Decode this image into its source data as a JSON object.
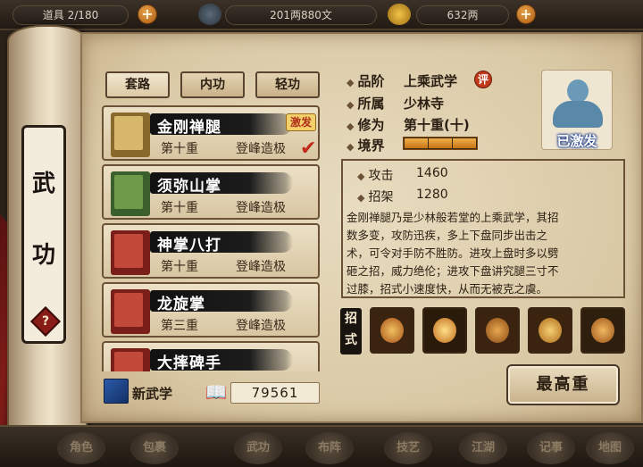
{
  "top_bar": {
    "resources": [
      {
        "label": "道具",
        "value": "2/180"
      },
      {
        "label": "银两",
        "value": "201两880文"
      },
      {
        "label": "元宝",
        "value": "632两"
      }
    ]
  },
  "side_scroll": {
    "title_chars": [
      "武",
      "功"
    ],
    "help_symbol": "?"
  },
  "tabs": [
    {
      "label": "套路",
      "active": true
    },
    {
      "label": "内功",
      "active": false
    },
    {
      "label": "轻功",
      "active": false
    }
  ],
  "skills": [
    {
      "name": "金刚禅腿",
      "level": "第十重",
      "grade": "登峰造极",
      "badge": "激发",
      "selected": true,
      "book_color": "#b08a3c"
    },
    {
      "name": "须弥山掌",
      "level": "第十重",
      "grade": "登峰造极",
      "badge": "",
      "selected": false,
      "book_color": "#4e7a3a"
    },
    {
      "name": "神掌八打",
      "level": "第十重",
      "grade": "登峰造极",
      "badge": "",
      "selected": false,
      "book_color": "#a8302a"
    },
    {
      "name": "龙旋掌",
      "level": "第三重",
      "grade": "登峰造极",
      "badge": "",
      "selected": false,
      "book_color": "#a8302a"
    },
    {
      "name": "大摔碑手",
      "level": "",
      "grade": "",
      "badge": "",
      "selected": false,
      "book_color": "#a8302a"
    }
  ],
  "new_skill_label": "新武学",
  "book_count": "79561",
  "detail": {
    "rank_label": "品阶",
    "rank_value": "上乘武学",
    "rate_badge": "评",
    "sect_label": "所属",
    "sect_value": "少林寺",
    "cultivation_label": "修为",
    "cultivation_value": "第十重(十)",
    "realm_label": "境界",
    "realm_level": 1.0,
    "portrait_status": "已激发",
    "stats": [
      {
        "label": "攻击",
        "value": "1460"
      },
      {
        "label": "招架",
        "value": "1280"
      }
    ],
    "description_lines": [
      "金刚禅腿乃是少林般若堂的上乘武学，其招",
      "数多变，攻防迅疾，多上下盘同步出击之",
      "术，可令对手防不胜防。进攻上盘时多以劈",
      "砸之招，威力绝伦；进攻下盘讲究腿三寸不",
      "过膝，招式小速度快，从而无被克之虞。"
    ],
    "moves_label": "招式",
    "moves": [
      {
        "icon": "kick-move-icon",
        "color": "#d88a2a"
      },
      {
        "icon": "fire-move-icon",
        "color": "#e0a040"
      },
      {
        "icon": "leap-move-icon",
        "color": "#c97a28"
      },
      {
        "icon": "spin-move-icon",
        "color": "#e6b050"
      },
      {
        "icon": "meditate-move-icon",
        "color": "#d89a48"
      }
    ]
  },
  "max_button_label": "最高重",
  "bottom_nav": [
    "角色",
    "包裹",
    "武功",
    "布阵",
    "技艺",
    "江湖",
    "记事",
    "地图"
  ]
}
